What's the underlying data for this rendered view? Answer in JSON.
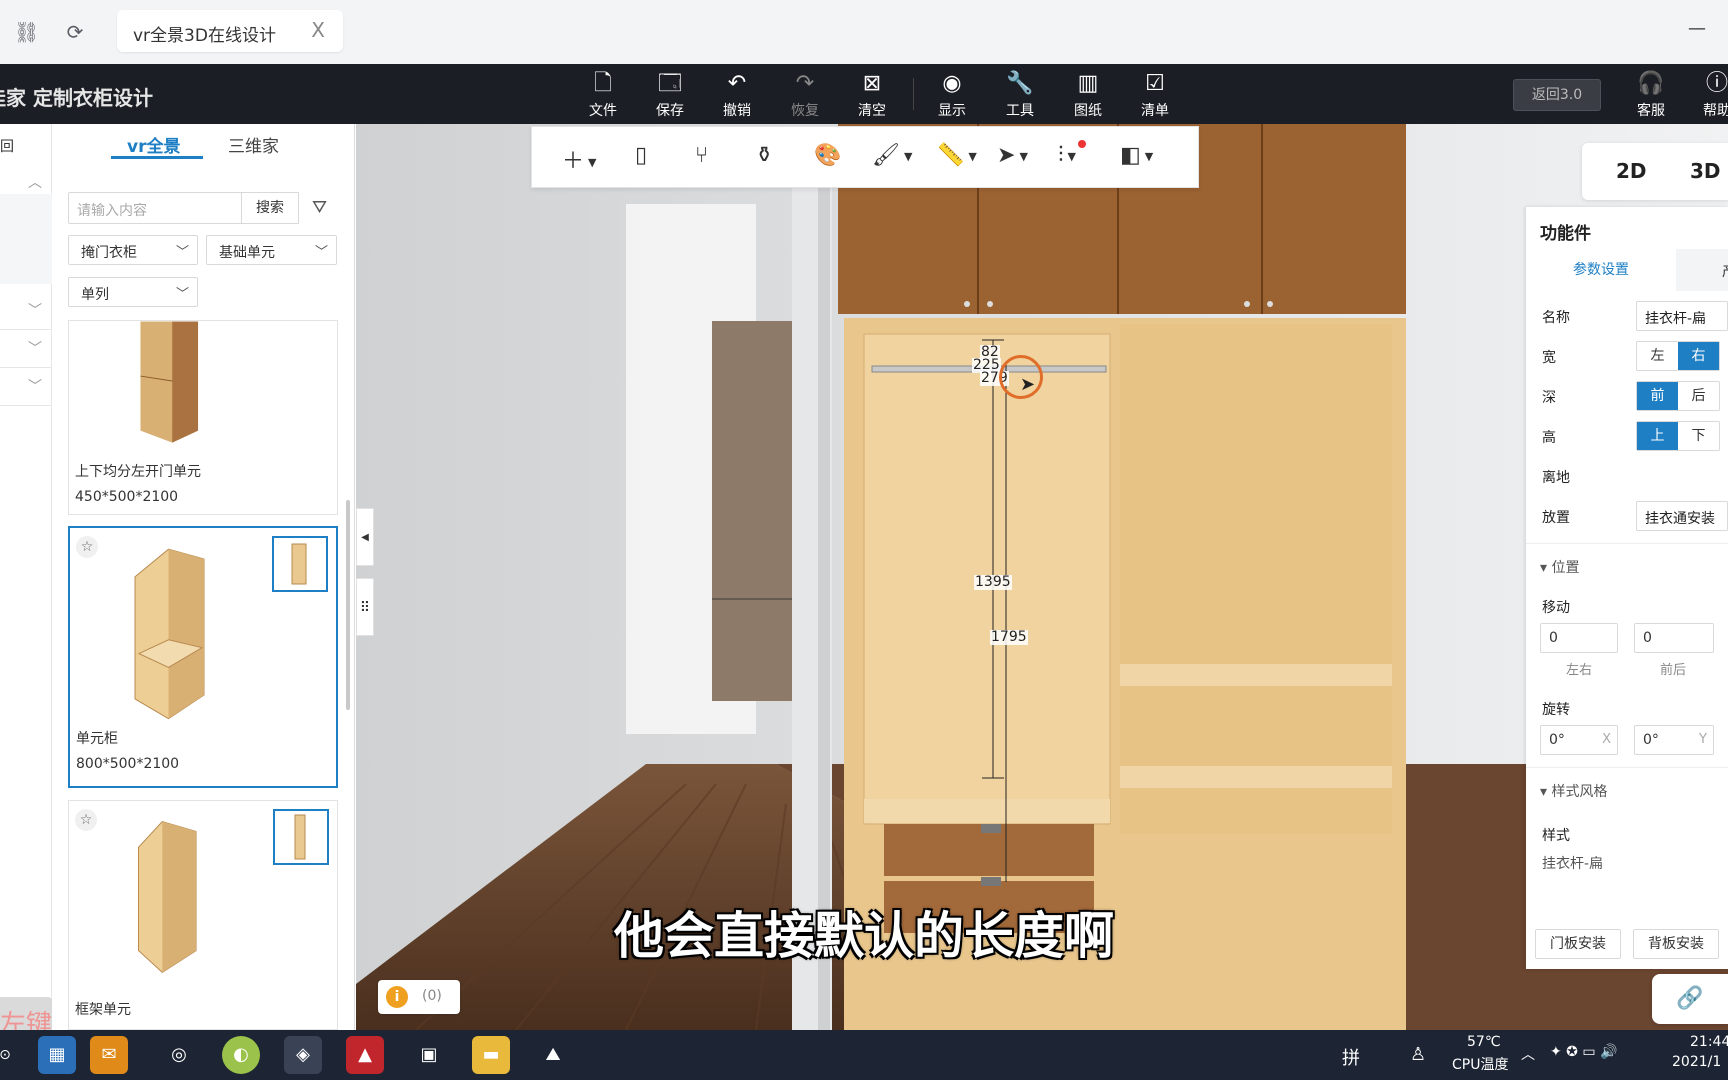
{
  "browser": {
    "tab_title": "vr全景3D在线设计",
    "close": "X",
    "minimize": "—"
  },
  "app": {
    "brand_prefix": "佳家",
    "title": "定制衣柜设计",
    "toolbar": [
      {
        "id": "file",
        "label": "文件",
        "icon": "file-icon"
      },
      {
        "id": "save",
        "label": "保存",
        "icon": "save-icon"
      },
      {
        "id": "undo",
        "label": "撤销",
        "icon": "undo-icon"
      },
      {
        "id": "redo",
        "label": "恢复",
        "icon": "redo-icon"
      },
      {
        "id": "clear",
        "label": "清空",
        "icon": "clear-icon"
      },
      {
        "id": "display",
        "label": "显示",
        "icon": "eye-icon"
      },
      {
        "id": "tools",
        "label": "工具",
        "icon": "wrench-icon"
      },
      {
        "id": "drawings",
        "label": "图纸",
        "icon": "map-icon"
      },
      {
        "id": "list",
        "label": "清单",
        "icon": "clipboard-icon"
      }
    ],
    "back3": "返回3.0",
    "service": "客服",
    "help": "帮助"
  },
  "left": {
    "back": "回",
    "tabs": [
      "vr全景",
      "三维家"
    ],
    "search_placeholder": "请输入内容",
    "search_button": "搜索",
    "filters": [
      "掩门衣柜",
      "基础单元",
      "单列"
    ],
    "items": [
      {
        "name": "上下均分左开门单元",
        "size": "450*500*2100"
      },
      {
        "name": "单元柜",
        "size": "800*500*2100"
      },
      {
        "name": "框架单元",
        "size": ""
      }
    ],
    "overlay_key": "左键"
  },
  "view": {
    "dims": [
      "82",
      "225",
      "279",
      "1395",
      "1795"
    ],
    "modes": [
      "2D",
      "3D"
    ],
    "info_count": "(0)",
    "subtitle": "他会直接默认的长度啊"
  },
  "right": {
    "title": "功能件",
    "tabs": [
      "参数设置",
      "产"
    ],
    "name_label": "名称",
    "name_value": "挂衣杆-扁",
    "width_label": "宽",
    "width_opts": [
      "左",
      "右"
    ],
    "depth_label": "深",
    "depth_opts": [
      "前",
      "后"
    ],
    "height_label": "高",
    "height_opts": [
      "上",
      "下"
    ],
    "ground_label": "离地",
    "place_label": "放置",
    "place_value": "挂衣通安装",
    "position_section": "位置",
    "move_label": "移动",
    "move_lr": "0",
    "move_fb": "0",
    "cap_lr": "左右",
    "cap_fb": "前后",
    "rotate_label": "旋转",
    "rot_x": "0°",
    "rot_y": "0°",
    "suffix_x": "X",
    "suffix_y": "Y",
    "style_section": "样式风格",
    "style_label": "样式",
    "style_value": "挂衣杆-扁",
    "btn_door": "门板安装",
    "btn_back": "背板安装"
  },
  "taskbar": {
    "temp": "57℃",
    "temp_label": "CPU温度",
    "ime": "拼",
    "time": "21:44",
    "date": "2021/1"
  },
  "colors": {
    "accent": "#1e7fc4",
    "appbar": "#1b1e24",
    "taskbar": "#1d2433",
    "wood_light": "#e9c98f",
    "wood_dark": "#9a5f2c",
    "floor": "#5e3d27"
  }
}
